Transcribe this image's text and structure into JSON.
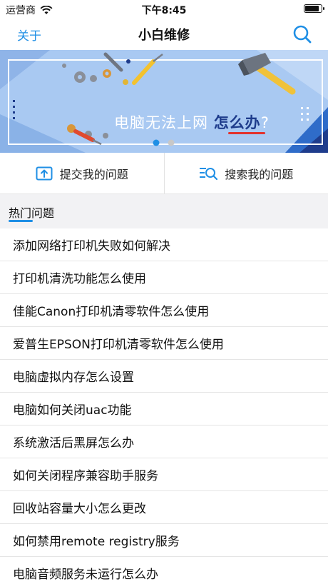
{
  "status_bar": {
    "carrier": "运营商",
    "time": "下午8:45"
  },
  "nav": {
    "left_label": "关于",
    "title": "小白维修"
  },
  "banner": {
    "text_main": "电脑无法上网",
    "text_highlight": "怎么办",
    "text_suffix": "?"
  },
  "actions": {
    "submit_label": "提交我的问题",
    "search_label": "搜索我的问题"
  },
  "section": {
    "title": "热门问题"
  },
  "questions": [
    "添加网络打印机失败如何解决",
    "打印机清洗功能怎么使用",
    "佳能Canon打印机清零软件怎么使用",
    "爱普生EPSON打印机清零软件怎么使用",
    "电脑虚拟内存怎么设置",
    "电脑如何关闭uac功能",
    "系统激活后黑屏怎么办",
    "如何关闭程序兼容助手服务",
    "回收站容量大小怎么更改",
    "如何禁用remote registry服务",
    "电脑音频服务未运行怎么办"
  ],
  "colors": {
    "accent": "#1f8fe5",
    "banner_bg": "#a9c9f2",
    "highlight_text": "#1e3c8c",
    "underline": "#e3322c"
  },
  "icons": [
    "wifi-icon",
    "battery-icon",
    "search-icon",
    "upload-icon",
    "search-list-icon",
    "hammer-icon",
    "screwdriver-icon",
    "gear-icon"
  ]
}
